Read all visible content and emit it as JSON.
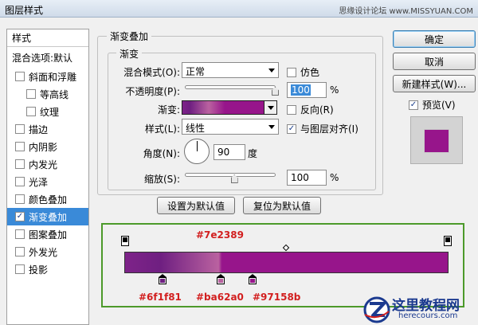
{
  "window": {
    "title": "图层样式",
    "watermark": "思缘设计论坛 www.MISSYUAN.COM"
  },
  "sidebar": {
    "header": "样式",
    "items": [
      {
        "label": "混合选项:默认",
        "checkbox": false,
        "checked": false
      },
      {
        "label": "斜面和浮雕",
        "checkbox": true,
        "checked": false
      },
      {
        "label": "等高线",
        "checkbox": true,
        "checked": false,
        "indent": true
      },
      {
        "label": "纹理",
        "checkbox": true,
        "checked": false,
        "indent": true
      },
      {
        "label": "描边",
        "checkbox": true,
        "checked": false
      },
      {
        "label": "内阴影",
        "checkbox": true,
        "checked": false
      },
      {
        "label": "内发光",
        "checkbox": true,
        "checked": false
      },
      {
        "label": "光泽",
        "checkbox": true,
        "checked": false
      },
      {
        "label": "颜色叠加",
        "checkbox": true,
        "checked": false
      },
      {
        "label": "渐变叠加",
        "checkbox": true,
        "checked": true,
        "selected": true
      },
      {
        "label": "图案叠加",
        "checkbox": true,
        "checked": false
      },
      {
        "label": "外发光",
        "checkbox": true,
        "checked": false
      },
      {
        "label": "投影",
        "checkbox": true,
        "checked": false
      }
    ]
  },
  "panel": {
    "group_title": "渐变叠加",
    "subgroup_title": "渐变",
    "blend_mode_label": "混合模式(O):",
    "blend_mode_value": "正常",
    "dither_label": "仿色",
    "dither_checked": false,
    "opacity_label": "不透明度(P):",
    "opacity_value": "100",
    "opacity_level": 1.0,
    "percent": "%",
    "gradient_label": "渐变:",
    "reverse_label": "反向(R)",
    "reverse_checked": false,
    "style_label": "样式(L):",
    "style_value": "线性",
    "align_label": "与图层对齐(I)",
    "align_checked": true,
    "angle_label": "角度(N):",
    "angle_value": "90",
    "degree": "度",
    "scale_label": "缩放(S):",
    "scale_value": "100",
    "scale_level": 0.55,
    "make_default": "设置为默认值",
    "reset_default": "复位为默认值"
  },
  "buttons": {
    "ok": "确定",
    "cancel": "取消",
    "new_style": "新建样式(W)...",
    "preview_label": "预览(V)",
    "preview_checked": true
  },
  "colors": {
    "stop1": "#7e2389",
    "stop2": "#6f1f81",
    "stop3": "#ba62a0",
    "stop4": "#97158b",
    "editor_border": "#4c9a2a",
    "annotation": "#d21f1f"
  },
  "gradient_editor": {
    "top_stop_label": "#7e2389",
    "bottom_stops": [
      {
        "label": "#6f1f81",
        "color": "#6f1f81"
      },
      {
        "label": "#ba62a0",
        "color": "#ba62a0"
      },
      {
        "label": "#97158b",
        "color": "#97158b"
      }
    ]
  },
  "logo": {
    "text": "这里教程网",
    "sub": "herecours.com",
    "icon": "z-logo-icon"
  }
}
